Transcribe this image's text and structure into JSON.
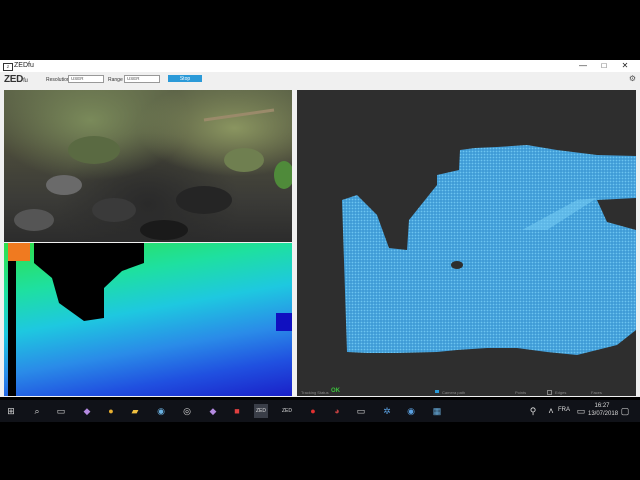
{
  "window": {
    "title": "ZEDfu",
    "minimize": "—",
    "maximize": "□",
    "close": "✕"
  },
  "toolbar": {
    "logo": "ZED",
    "logo_suffix": "fu",
    "resolution_label": "Resolution",
    "resolution_value": "USER",
    "range_label": "Range",
    "range_value": "USER",
    "stop_label": "Stop"
  },
  "status": {
    "tracking_label": "Tracking Status",
    "tracking_value": "OK",
    "camera_label": "Camera path",
    "points_label": "Points",
    "edges_label": "Edges",
    "faces_label": "Faces"
  },
  "taskbar": {
    "language": "FRA",
    "time": "16:27",
    "date": "13/07/2018",
    "icons": [
      "windows-icon",
      "search-icon",
      "task-view-icon",
      "visual-studio-icon",
      "chrome-icon",
      "file-explorer-icon",
      "steam-icon",
      "unity-icon",
      "visual-studio-icon",
      "app-icon",
      "zed-icon",
      "zed-icon",
      "app-icon",
      "app-icon",
      "vr-icon",
      "app-icon",
      "app-icon",
      "app-icon"
    ]
  },
  "colors": {
    "accent": "#2b9ad8",
    "tracking_ok": "#3cc13c",
    "cloud": "#4aa8e0"
  }
}
